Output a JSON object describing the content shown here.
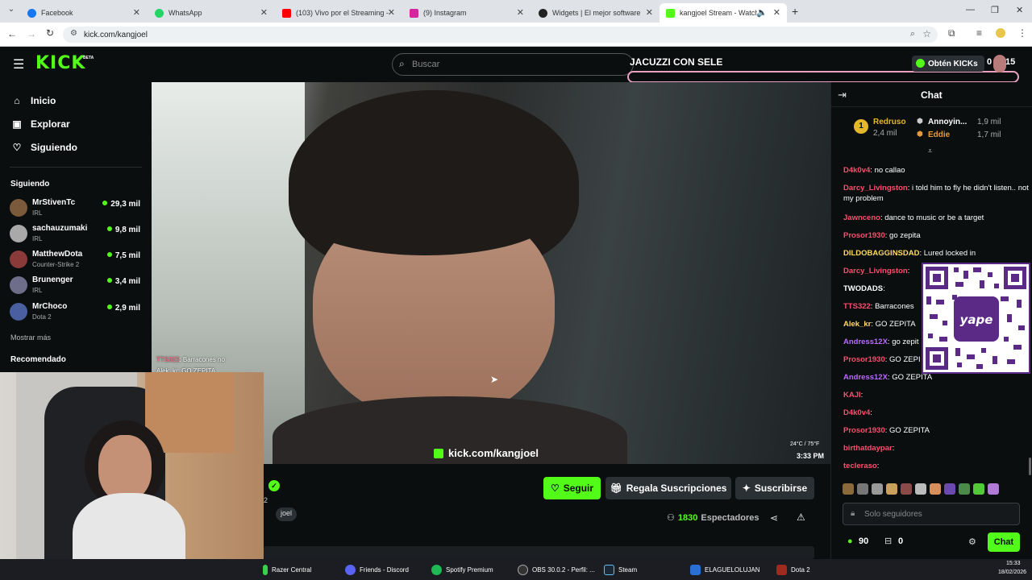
{
  "browser": {
    "tabs": [
      {
        "label": "Facebook",
        "color": "#1877f2"
      },
      {
        "label": "WhatsApp",
        "color": "#25d366"
      },
      {
        "label": "(103) Vivo por el Streaming - Yo",
        "color": "#ff0000"
      },
      {
        "label": "(9) Instagram",
        "color": "#d6249f"
      },
      {
        "label": "Widgets | El mejor software par",
        "color": "#222222"
      },
      {
        "label": "kangjoel Stream - Watch Li",
        "color": "#53fc18"
      }
    ],
    "url": "kick.com/kangjoel"
  },
  "header": {
    "logo": "KICK",
    "logo_badge": "BETA",
    "search_placeholder": "Buscar",
    "get_kicks": "Obtén KICKs",
    "kicks_count": "0",
    "overlay_count": "15"
  },
  "overlay_banner": "JACUZZI CON SELE",
  "sidebar": {
    "nav": [
      {
        "label": "Inicio",
        "icon": "home-icon"
      },
      {
        "label": "Explorar",
        "icon": "compass-icon"
      },
      {
        "label": "Siguiendo",
        "icon": "heart-icon"
      }
    ],
    "following_title": "Siguiendo",
    "channels": [
      {
        "name": "MrStivenTc",
        "category": "IRL",
        "viewers": "29,3 mil"
      },
      {
        "name": "sachauzumaki",
        "category": "IRL",
        "viewers": "9,8 mil"
      },
      {
        "name": "MatthewDota",
        "category": "Counter-Strike 2",
        "viewers": "7,5 mil"
      },
      {
        "name": "Brunenger",
        "category": "IRL",
        "viewers": "3,4 mil"
      },
      {
        "name": "MrChoco",
        "category": "Dota 2",
        "viewers": "2,9 mil"
      }
    ],
    "show_more": "Mostrar más",
    "recommended_title": "Recomendado"
  },
  "video": {
    "watermark": "kick.com/kangjoel",
    "weather": "24°C / 75°F",
    "time": "3:33 PM",
    "overlay_chat": [
      {
        "user": "TTS322",
        "text": "Barracones no"
      },
      {
        "user": "Alek_kr",
        "text": "GO ZEPITA"
      }
    ]
  },
  "stream_info": {
    "streamer_partial": "2",
    "tag": "joel",
    "follow": "Seguir",
    "gift_subs": "Regala Suscripciones",
    "subscribe": "Suscribirse",
    "viewers": "1830",
    "viewers_label": "Espectadores"
  },
  "chat": {
    "title": "Chat",
    "leaderboard": [
      {
        "rank": "1",
        "name": "Redruso",
        "amount": "2,4 mil"
      },
      {
        "name": "Annoyin...",
        "amount": "1,9 mil"
      },
      {
        "name": "Eddie",
        "amount": "1,7 mil"
      }
    ],
    "messages": [
      {
        "user": "D4k0v4",
        "text": "no callao",
        "color": "#ff4d6d"
      },
      {
        "user": "Darcy_Livingston",
        "text": "i told him to fly he didn't listen.. not my problem",
        "color": "#ff4d6d"
      },
      {
        "user": "Jawnceno",
        "text": "dance to music or be a target",
        "color": "#ff4d6d"
      },
      {
        "user": "Prosor1930",
        "text": "go zepita",
        "color": "#ff4d6d"
      },
      {
        "user": "DILDOBAGGINSDAD",
        "text": "Lured locked in",
        "color": "#ffd966"
      },
      {
        "user": "Darcy_Livingston",
        "text": "",
        "color": "#ff4d6d"
      },
      {
        "user": "TWODADS",
        "text": "",
        "color": "#ffffff"
      },
      {
        "user": "TTS322",
        "text": "Barracones",
        "color": "#ff4d6d"
      },
      {
        "user": "Alek_kr",
        "text": "GO ZEPITA",
        "color": "#ffd966"
      },
      {
        "user": "Andress12X",
        "text": "go zepit",
        "color": "#b86bff"
      },
      {
        "user": "Prosor1930",
        "text": "GO ZEPI",
        "color": "#ff4d6d"
      },
      {
        "user": "Andress12X",
        "text": "GO ZEPITA",
        "color": "#b86bff"
      },
      {
        "user": "KAJI",
        "text": "",
        "color": "#ff4d6d"
      },
      {
        "user": "D4k0v4",
        "text": "",
        "color": "#ff4d6d"
      },
      {
        "user": "Prosor1930",
        "text": "GO ZEPITA",
        "color": "#ff4d6d"
      },
      {
        "user": "birthatdaypar",
        "text": "",
        "color": "#ff4d6d"
      },
      {
        "user": "tecleraso",
        "text": "",
        "color": "#ff4d6d"
      }
    ],
    "input_placeholder": "Solo seguidores",
    "points": "90",
    "gift_count": "0",
    "send": "Chat",
    "qr_label": "yape"
  },
  "taskbar": {
    "items": [
      "Razer Central",
      "Friends - Discord",
      "Spotify Premium",
      "OBS 30.0.2 - Perfil: ...",
      "Steam",
      "ELAGUELOLUJAN",
      "Dota 2"
    ],
    "time": "15:33",
    "date": "18/02/2026"
  },
  "colors": {
    "kick_green": "#53fc18",
    "bg": "#0b0e0f"
  }
}
